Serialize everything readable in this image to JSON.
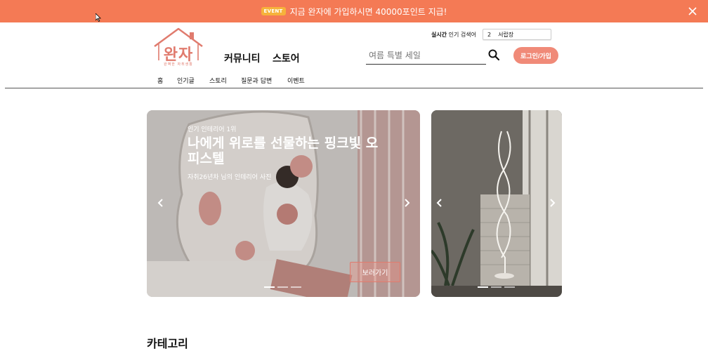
{
  "event_banner": {
    "badge": "EVENT",
    "message": "지금 완자에 가입하시면 40000포인트 지급!",
    "bg_color": "#f47a55"
  },
  "logo": {
    "name": "완자",
    "tagline": "완벽한 자취생활",
    "color": "#e07b6e"
  },
  "main_nav": [
    "커뮤니티",
    "스토어"
  ],
  "trending": {
    "label_bold": "실시간",
    "label_rest": " 인기 검색어",
    "rank": "2",
    "keyword": "서랍장"
  },
  "search": {
    "placeholder": "여름 특별 세일",
    "icon": "search-icon"
  },
  "login_button": "로그인/가입",
  "sub_nav": [
    "홈",
    "인기글",
    "스토리",
    "질문과 답변",
    "이벤트"
  ],
  "hero": {
    "eyebrow": "인기 인테리어 1위",
    "title": "나에게 위로를 선물하는 핑크빛 오피스텔",
    "caption": "자취26년차 님의 인테리어 사진",
    "more_button": "보러가기",
    "accent": "#f08a78"
  },
  "section": {
    "title": "카테고리"
  }
}
